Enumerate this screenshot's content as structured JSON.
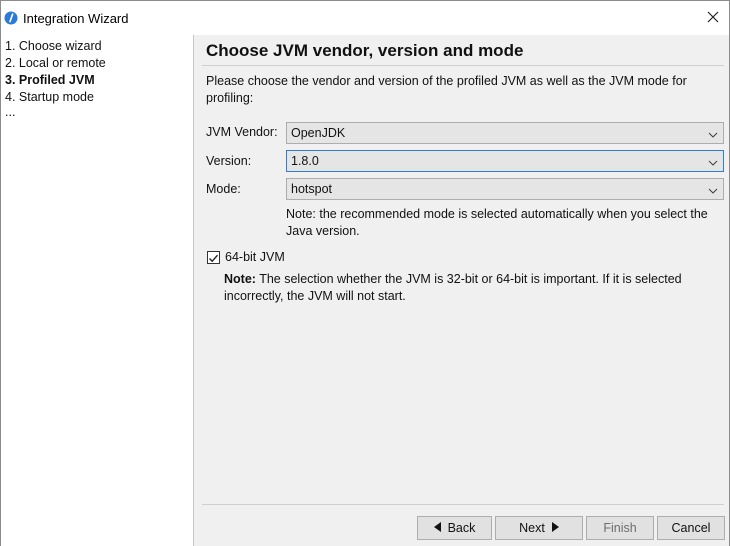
{
  "window": {
    "title": "Integration Wizard"
  },
  "steps": [
    {
      "label": "1. Choose wizard",
      "current": false
    },
    {
      "label": "2. Local or remote",
      "current": false
    },
    {
      "label": "3. Profiled JVM",
      "current": true
    },
    {
      "label": "4. Startup mode",
      "current": false
    },
    {
      "label": "...",
      "current": false
    }
  ],
  "main": {
    "title": "Choose JVM vendor, version and mode",
    "description": "Please choose the vendor and version of the profiled JVM as well as the JVM mode for profiling:",
    "fields": [
      {
        "label": "JVM Vendor:",
        "value": "OpenJDK"
      },
      {
        "label": "Version:",
        "value": "1.8.0"
      },
      {
        "label": "Mode:",
        "value": "hotspot"
      }
    ],
    "mode_note": "Note: the recommended mode is selected automatically when you select the Java version.",
    "checkbox": {
      "label": "64-bit JVM",
      "checked": true
    },
    "bit_note_bold": "Note:",
    "bit_note_text": " The selection whether the JVM is 32-bit or 64-bit is important. If it is selected incorrectly, the JVM will not start."
  },
  "buttons": {
    "back": "Back",
    "next": "Next",
    "finish": "Finish",
    "cancel": "Cancel"
  },
  "colors": {
    "accent": "#2f7fd0",
    "panel_bg": "#f0f0f0",
    "icon_blue": "#2b7bd6"
  },
  "icons": {
    "app": "wizard-info-icon",
    "close": "close-icon",
    "dropdown": "chevron-down-icon",
    "back": "triangle-left-icon",
    "next": "triangle-right-icon"
  }
}
